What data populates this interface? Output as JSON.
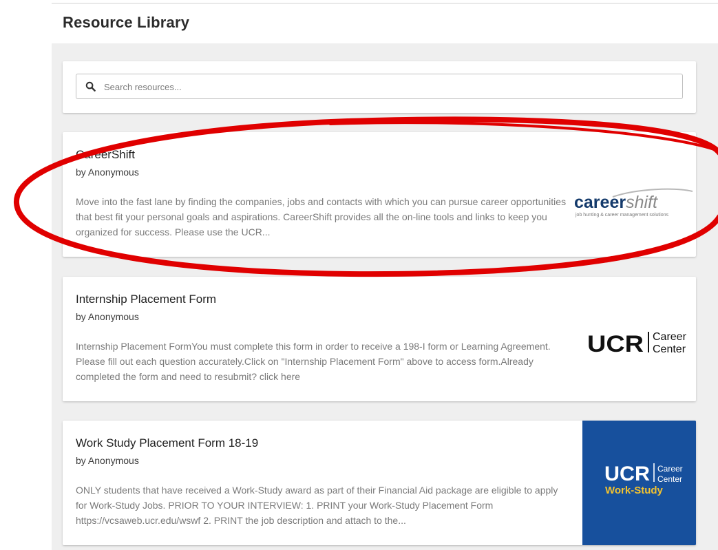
{
  "page": {
    "title": "Resource Library"
  },
  "search": {
    "placeholder": "Search resources...",
    "value": ""
  },
  "resources": [
    {
      "title": "CareerShift",
      "author": "by Anonymous",
      "description": "Move into the fast lane by finding the companies, jobs and contacts with which you can pursue career opportunities that best fit your personal goals and aspirations. CareerShift provides all the on-line tools and links to keep you organized for success. Please use the UCR...",
      "logo": {
        "name": "careershift-logo",
        "main": "career",
        "accent": "shift",
        "tagline": "job hunting & career management solutions"
      }
    },
    {
      "title": "Internship Placement Form",
      "author": "by Anonymous",
      "description": " Internship Placement FormYou must complete this form in order to receive a 198-I form or Learning Agreement. Please fill out each question accurately.Click on \"Internship Placement Form\" above to access form.Already completed the form and need to resubmit? click here",
      "logo": {
        "name": "ucr-career-center-logo",
        "mark": "UCR",
        "line1": "Career",
        "line2": "Center"
      }
    },
    {
      "title": "Work Study Placement Form 18-19",
      "author": "by Anonymous",
      "description": "ONLY students that have received a Work-Study award as part of their Financial Aid package are eligible to apply for Work-Study Jobs.  PRIOR TO YOUR INTERVIEW:  1. PRINT your Work-Study Placement Form https://vcsaweb.ucr.edu/wswf   2. PRINT the job description and attach to the...",
      "logo": {
        "name": "ucr-work-study-logo",
        "mark": "UCR",
        "line1": "Career",
        "line2": "Center",
        "line3": "Work-Study"
      }
    }
  ],
  "colors": {
    "panel_bg": "#efefef",
    "annotation_red": "#e00000",
    "workstudy_blue": "#17509d",
    "workstudy_gold": "#f2c230"
  }
}
